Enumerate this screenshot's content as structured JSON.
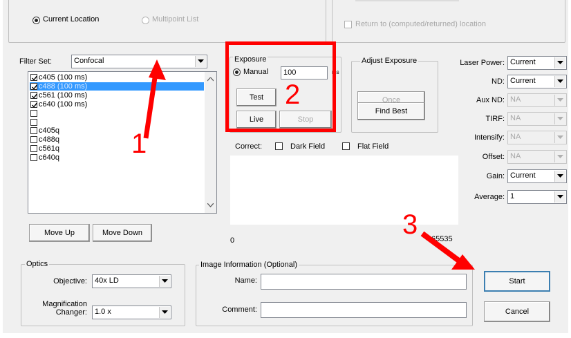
{
  "location": {
    "current_label": "Current Location",
    "multipoint_label": "Multipoint List",
    "return_label": "Return to (computed/returned) location"
  },
  "filter": {
    "label": "Filter Set:",
    "value": "Confocal",
    "items": [
      {
        "label": "c405 (100 ms)",
        "checked": true,
        "selected": false
      },
      {
        "label": "c488 (100 ms)",
        "checked": true,
        "selected": true
      },
      {
        "label": "c561 (100 ms)",
        "checked": true,
        "selected": false
      },
      {
        "label": "c640 (100 ms)",
        "checked": true,
        "selected": false
      },
      {
        "label": "",
        "checked": false,
        "selected": false
      },
      {
        "label": "",
        "checked": false,
        "selected": false
      },
      {
        "label": "c405q",
        "checked": false,
        "selected": false
      },
      {
        "label": "c488q",
        "checked": false,
        "selected": false
      },
      {
        "label": "c561q",
        "checked": false,
        "selected": false
      },
      {
        "label": "c640q",
        "checked": false,
        "selected": false
      }
    ],
    "move_up_label": "Move Up",
    "move_down_label": "Move Down"
  },
  "exposure": {
    "title": "Exposure",
    "manual_label": "Manual",
    "value": "100",
    "unit": "ms",
    "test_label": "Test",
    "live_label": "Live",
    "stop_label": "Stop"
  },
  "adjust": {
    "title": "Adjust Exposure",
    "once_label": "Once",
    "find_best_label": "Find Best"
  },
  "correct": {
    "label": "Correct:",
    "dark_field_label": "Dark Field",
    "flat_field_label": "Flat Field"
  },
  "histogram": {
    "min_label": "0",
    "max_label": "65535"
  },
  "laser": {
    "fields": [
      {
        "label": "Laser Power:",
        "value": "Current",
        "enabled": true
      },
      {
        "label": "ND:",
        "value": "Current",
        "enabled": true
      },
      {
        "label": "Aux ND:",
        "value": "NA",
        "enabled": false
      },
      {
        "label": "TIRF:",
        "value": "NA",
        "enabled": false
      },
      {
        "label": "Intensify:",
        "value": "NA",
        "enabled": false
      },
      {
        "label": "Offset:",
        "value": "NA",
        "enabled": false
      },
      {
        "label": "Gain:",
        "value": "Current",
        "enabled": true
      },
      {
        "label": "Average:",
        "value": "1",
        "enabled": true
      }
    ]
  },
  "optics": {
    "title": "Optics",
    "objective_label": "Objective:",
    "objective_value": "40x LD",
    "mag_label_1": "Magnification",
    "mag_label_2": "Changer:",
    "mag_value": "1.0 x"
  },
  "image_info": {
    "title": "Image Information (Optional)",
    "name_label": "Name:",
    "name_value": "",
    "comment_label": "Comment:",
    "comment_value": ""
  },
  "actions": {
    "start_label": "Start",
    "cancel_label": "Cancel"
  },
  "annotations": {
    "one": "1",
    "two": "2",
    "three": "3",
    "color": "#ff0000"
  }
}
